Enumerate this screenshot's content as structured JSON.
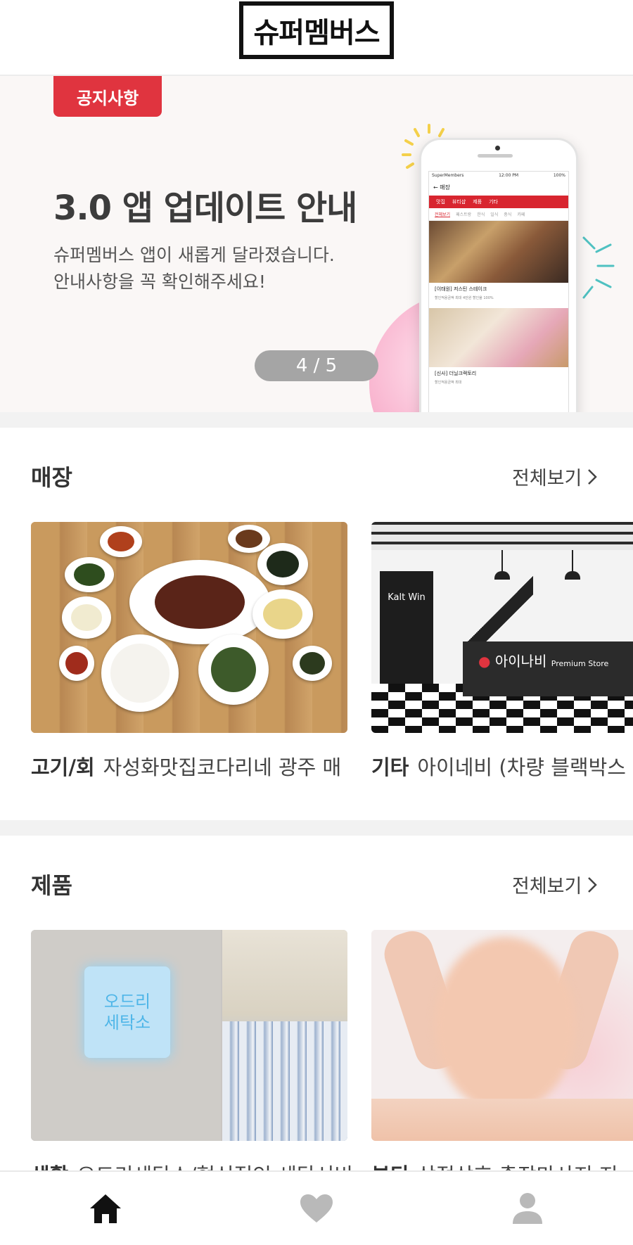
{
  "header": {
    "logo_text": "슈퍼멤버스"
  },
  "banner": {
    "badge": "공지사항",
    "title": "3.0 앱 업데이트 안내",
    "desc_line1": "슈퍼멤버스 앱이 새롭게 달라졌습니다.",
    "desc_line2": "안내사항을 꼭 확인해주세요!",
    "pager": "4 / 5",
    "phone": {
      "status_left": "SuperMembers",
      "status_time": "12:00 PM",
      "status_right": "100%",
      "screen_title": "매장",
      "tabs": [
        "맛집",
        "뷰티샵",
        "제품",
        "기타"
      ],
      "subtabs": [
        "전체보기",
        "패스트랑",
        "한식",
        "일식",
        "중식",
        "카페"
      ],
      "card1_title": "[이태원] 저스틴 스테이크",
      "card1_meta": "할인적용금액 최대 4만원   할인율 100%",
      "card2_title": "[신사] 더닐크랙토리",
      "card2_meta": "할인적용금액 최대"
    }
  },
  "stores": {
    "title": "매장",
    "see_all": "전체보기",
    "items": [
      {
        "category": "고기/회",
        "name": "자성화맛집코다리네 광주 매",
        "image": "food-photo"
      },
      {
        "category": "기타",
        "name": "아이네비 (차량 블랙박스",
        "image": "store-interior-photo",
        "sign": "아이나비",
        "sign_sub": "Premium Store",
        "banner": "Kalt Win"
      }
    ]
  },
  "products": {
    "title": "제품",
    "see_all": "전체보기",
    "items": [
      {
        "category": "생활",
        "name": "오드리세탁소/혁신적인 세탁서비",
        "image": "laundry-photo",
        "sign": "오드리\n세탁소"
      },
      {
        "category": "뷰티",
        "name": "상점상호 출장마사지 지",
        "image": "massage-photo"
      }
    ]
  },
  "nav": {
    "items": [
      {
        "id": "home",
        "icon": "home-icon",
        "active": true
      },
      {
        "id": "favorites",
        "icon": "heart-icon",
        "active": false
      },
      {
        "id": "profile",
        "icon": "person-icon",
        "active": false
      }
    ]
  },
  "colors": {
    "brand_red": "#e0343f",
    "text_dark": "#333333",
    "icon_active": "#111111",
    "icon_inactive": "#b9b9b9"
  }
}
